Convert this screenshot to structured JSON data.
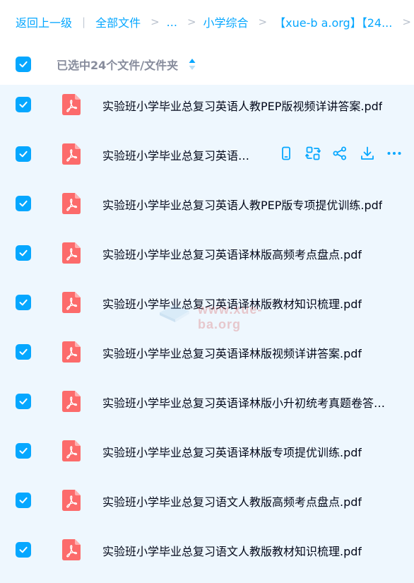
{
  "breadcrumb": {
    "back_label": "返回上一级",
    "pipe": "|",
    "all_files_label": "全部文件",
    "sep": ">",
    "ellipsis": "...",
    "level1": "小学综合",
    "level2": "【xue-b a.org】【24...",
    "level3_cut": "【2"
  },
  "header": {
    "selection_text": "已选中24个文件/文件夹",
    "sort_icon": "sort-updown-icon"
  },
  "files": [
    {
      "name": "实验班小学毕业总复习英语人教PEP版视频详讲答案.pdf"
    },
    {
      "name": "实验班小学毕业总复习英语人教PEP版小升初统考真题卷答案.pdf"
    },
    {
      "name": "实验班小学毕业总复习英语人教PEP版专项提优训练.pdf"
    },
    {
      "name": "实验班小学毕业总复习英语译林版高频考点盘点.pdf"
    },
    {
      "name": "实验班小学毕业总复习英语译林版教材知识梳理.pdf"
    },
    {
      "name": "实验班小学毕业总复习英语译林版视频详讲答案.pdf"
    },
    {
      "name": "实验班小学毕业总复习英语译林版小升初统考真题卷答案.pdf"
    },
    {
      "name": "实验班小学毕业总复习英语译林版专项提优训练.pdf"
    },
    {
      "name": "实验班小学毕业总复习语文人教版高频考点盘点.pdf"
    },
    {
      "name": "实验班小学毕业总复习语文人教版教材知识梳理.pdf"
    }
  ],
  "hover_actions": [
    "phone-icon",
    "transfer-icon",
    "share-icon",
    "download-icon",
    "more-icon"
  ],
  "watermark": {
    "text": "www.xue-ba.org"
  },
  "colors": {
    "accent": "#06a7ff",
    "pdf_red": "#fc6b6b",
    "list_bg": "#eef7fe",
    "text": "#03081a",
    "muted": "#878c9c"
  }
}
